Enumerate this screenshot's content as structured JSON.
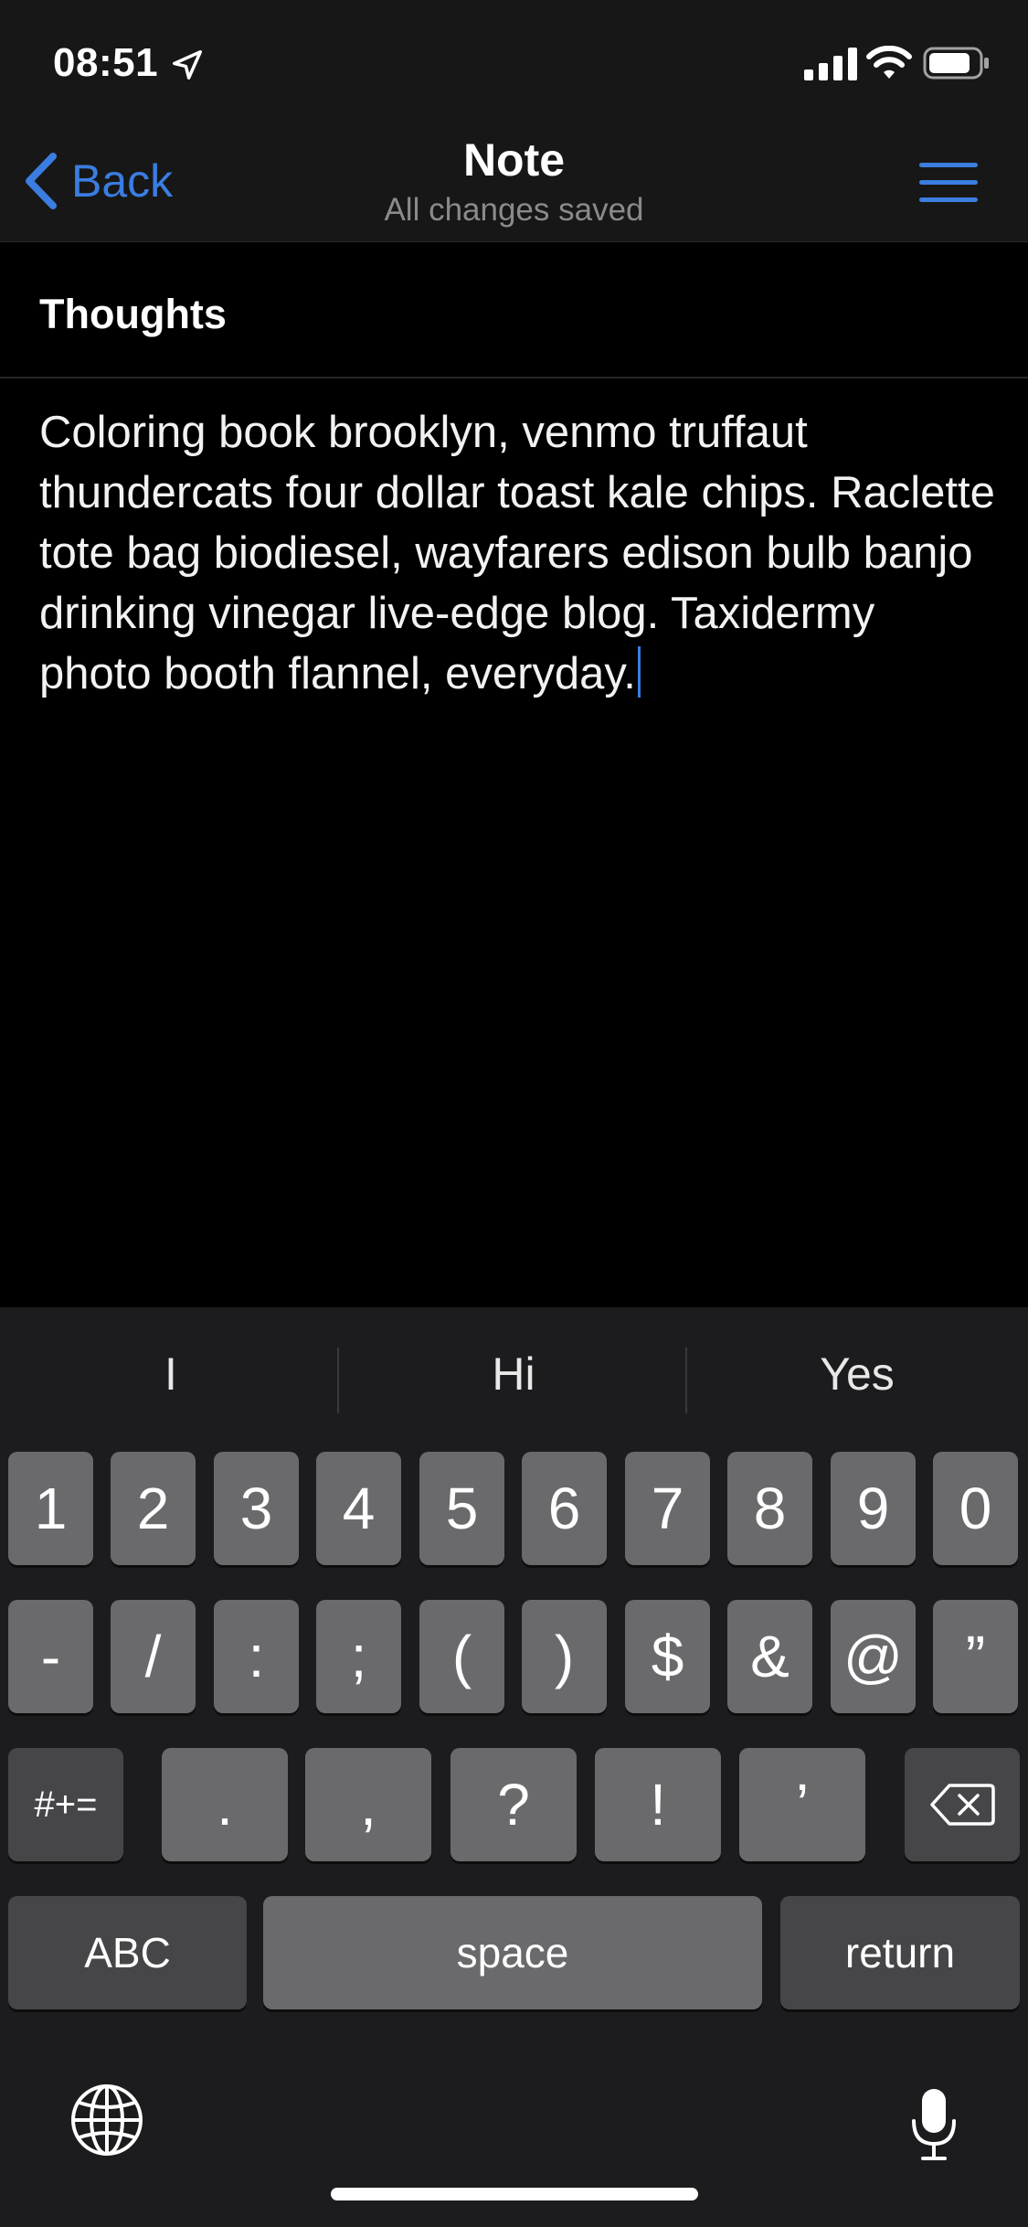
{
  "status_bar": {
    "time": "08:51"
  },
  "nav": {
    "back_label": "Back",
    "title": "Note",
    "subtitle": "All changes saved"
  },
  "note": {
    "title": "Thoughts",
    "body": "Coloring book brooklyn, venmo truffaut thundercats four dollar toast kale chips. Raclette tote bag biodiesel, wayfarers edison bulb banjo drinking vinegar live-edge blog. Taxidermy photo booth flannel, everyday."
  },
  "keyboard": {
    "suggestions": [
      "I",
      "Hi",
      "Yes"
    ],
    "row1": [
      "1",
      "2",
      "3",
      "4",
      "5",
      "6",
      "7",
      "8",
      "9",
      "0"
    ],
    "row2": [
      "-",
      "/",
      ":",
      ";",
      "(",
      ")",
      "$",
      "&",
      "@",
      "”"
    ],
    "row3": {
      "shift_label": "#+=",
      "keys": [
        ".",
        ",",
        "?",
        "!",
        "’"
      ]
    },
    "row4": {
      "abc_label": "ABC",
      "space_label": "space",
      "return_label": "return"
    }
  },
  "colors": {
    "accent": "#3b7de0",
    "background": "#000000",
    "bar_background": "#171717",
    "key": "#6a6a6d",
    "key_dark": "#464649",
    "keyboard_background": "#1c1c1e"
  },
  "icons": {
    "location": "location-arrow-icon",
    "signal": "cellular-signal-icon",
    "wifi": "wifi-icon",
    "battery": "battery-icon",
    "back": "chevron-left-icon",
    "menu": "hamburger-menu-icon",
    "backspace": "backspace-icon",
    "globe": "globe-icon",
    "mic": "microphone-icon"
  }
}
